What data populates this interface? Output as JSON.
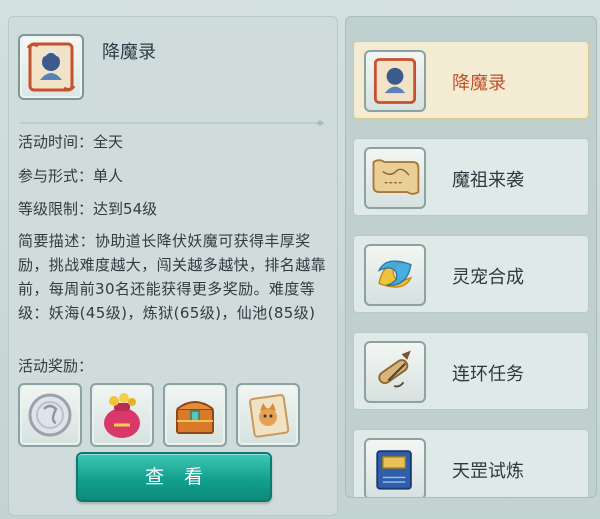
{
  "activity": {
    "title": "降魔录",
    "icon": "demon-scroll-icon",
    "time_label": "活动时间",
    "time_value": "全天",
    "form_label": "参与形式",
    "form_value": "单人",
    "level_label": "等级限制",
    "level_value": "达到54级",
    "colon": "：",
    "description": "简要描述：协助道长降伏妖魔可获得丰厚奖励，挑战难度越大，闯关越多越快，排名越靠前，每周前30名还能获得更多奖励。难度等级：妖海(45级)，炼狱(65级)，仙池(85级)",
    "rewards_label": "活动奖励：",
    "rewards": [
      {
        "icon": "silver-coin-icon"
      },
      {
        "icon": "gold-bag-icon"
      },
      {
        "icon": "treasure-chest-icon"
      },
      {
        "icon": "dog-scroll-icon"
      }
    ],
    "view_button": "查看"
  },
  "activity_list": [
    {
      "label": "降魔录",
      "icon": "demon-scroll-icon",
      "selected": true
    },
    {
      "label": "魔祖来袭",
      "icon": "map-scroll-icon",
      "selected": false
    },
    {
      "label": "灵宠合成",
      "icon": "spirit-pet-icon",
      "selected": false
    },
    {
      "label": "连环任务",
      "icon": "quest-scroll-icon",
      "selected": false
    },
    {
      "label": "天罡试炼",
      "icon": "trial-book-icon",
      "selected": false
    }
  ],
  "colors": {
    "accent_button": "#13a08f",
    "selected_label": "#c0502c",
    "selected_bg": "#f3ecd2"
  }
}
